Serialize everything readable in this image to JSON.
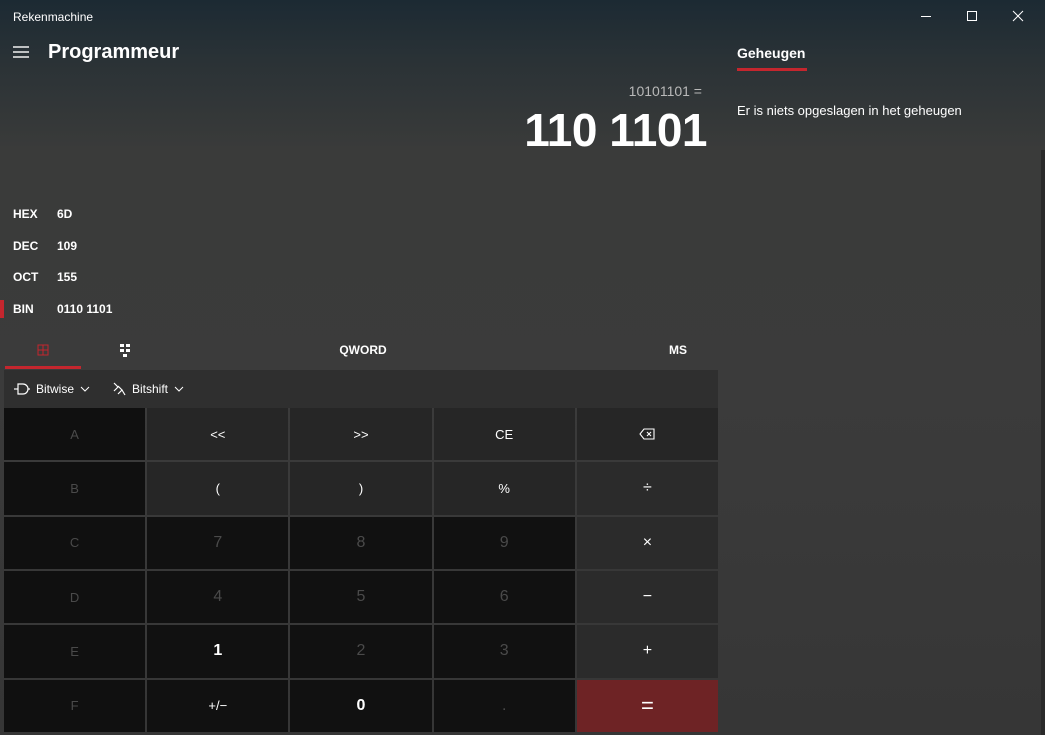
{
  "window": {
    "title": "Rekenmachine",
    "minimize_icon": "minimize-icon",
    "maximize_icon": "maximize-icon",
    "close_icon": "close-icon"
  },
  "header": {
    "menu_icon": "hamburger-icon",
    "mode": "Programmeur"
  },
  "display": {
    "expression": "10101101 =",
    "result": "110 1101"
  },
  "radix": [
    {
      "label": "HEX",
      "value": "6D"
    },
    {
      "label": "DEC",
      "value": "109"
    },
    {
      "label": "OCT",
      "value": "155"
    },
    {
      "label": "BIN",
      "value": "0110 1101"
    }
  ],
  "radix_active": "BIN",
  "toolbar": {
    "keypad_icon": "full-keypad-icon",
    "bit_toggle_icon": "bit-toggle-keypad-icon",
    "word_size": "QWORD",
    "memory_store": "MS"
  },
  "bitbar": {
    "bitwise": "Bitwise",
    "bitshift": "Bitshift"
  },
  "keys": {
    "row1": [
      "A",
      "<<",
      ">>",
      "CE",
      "⌫"
    ],
    "row2": [
      "B",
      "(",
      ")",
      "%",
      "÷"
    ],
    "row3": [
      "C",
      "7",
      "8",
      "9",
      "×"
    ],
    "row4": [
      "D",
      "4",
      "5",
      "6",
      "−"
    ],
    "row5": [
      "E",
      "1",
      "2",
      "3",
      "+"
    ],
    "row6": [
      "F",
      "+/−",
      "0",
      ".",
      "="
    ]
  },
  "memory": {
    "tab": "Geheugen",
    "empty_text": "Er is niets opgeslagen in het geheugen"
  },
  "colors": {
    "accent": "#c4262e",
    "equals_bg": "#6e2325"
  }
}
